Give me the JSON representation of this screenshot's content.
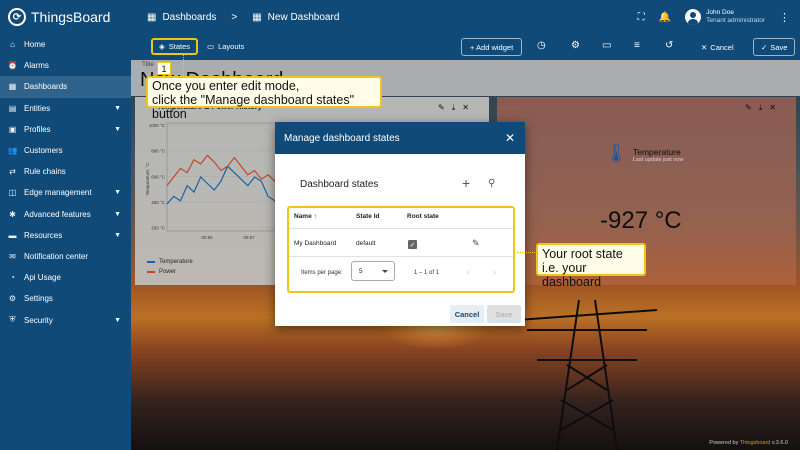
{
  "app": {
    "logo_text": "ThingsBoard"
  },
  "sidebar": {
    "items": [
      {
        "label": "Home",
        "icon": "home-icon",
        "glyph": "⌂",
        "expandable": false,
        "active": false
      },
      {
        "label": "Alarms",
        "icon": "alarm-icon",
        "glyph": "⏰",
        "expandable": false,
        "active": false
      },
      {
        "label": "Dashboards",
        "icon": "dashboards-icon",
        "glyph": "▦",
        "expandable": false,
        "active": true
      },
      {
        "label": "Entities",
        "icon": "entities-icon",
        "glyph": "▤",
        "expandable": true,
        "active": false
      },
      {
        "label": "Profiles",
        "icon": "profiles-icon",
        "glyph": "▣",
        "expandable": true,
        "active": false
      },
      {
        "label": "Customers",
        "icon": "customers-icon",
        "glyph": "👥",
        "expandable": false,
        "active": false
      },
      {
        "label": "Rule chains",
        "icon": "rule-chains-icon",
        "glyph": "⇄",
        "expandable": false,
        "active": false
      },
      {
        "label": "Edge management",
        "icon": "edge-icon",
        "glyph": "◫",
        "expandable": true,
        "active": false
      },
      {
        "label": "Advanced features",
        "icon": "advanced-icon",
        "glyph": "✱",
        "expandable": true,
        "active": false
      },
      {
        "label": "Resources",
        "icon": "resources-icon",
        "glyph": "▬",
        "expandable": true,
        "active": false
      },
      {
        "label": "Notification center",
        "icon": "notification-icon",
        "glyph": "✉",
        "expandable": false,
        "active": false
      },
      {
        "label": "Api Usage",
        "icon": "api-usage-icon",
        "glyph": "◔",
        "expandable": false,
        "active": false
      },
      {
        "label": "Settings",
        "icon": "settings-icon",
        "glyph": "⚙",
        "expandable": false,
        "active": false
      },
      {
        "label": "Security",
        "icon": "security-icon",
        "glyph": "⛨",
        "expandable": true,
        "active": false
      }
    ]
  },
  "header": {
    "breadcrumb_root": "Dashboards",
    "breadcrumb_separator": ">",
    "breadcrumb_current": "New Dashboard",
    "user_name": "John Doe",
    "user_role": "Tenant administrator"
  },
  "toolbar": {
    "states_label": "States",
    "layouts_label": "Layouts",
    "add_widget_label": "+ Add widget",
    "cancel_label": "Cancel",
    "save_label": "Save"
  },
  "dashboard": {
    "title_label": "Title",
    "title": "New Dashboard"
  },
  "widget_chart": {
    "title": "Temperature & Power History",
    "legend": [
      {
        "name": "Temperature",
        "color": "#1f77d0"
      },
      {
        "name": "Power",
        "color": "#e85a3a"
      }
    ]
  },
  "chart_data": {
    "type": "line",
    "title": "",
    "ylabel": "Temperature, °C",
    "yticks": [
      "1000 °C",
      "800 °C",
      "600 °C",
      "400 °C",
      "200 °C"
    ],
    "xticks": [
      "00:55",
      "00:57",
      "00:59"
    ],
    "series": [
      {
        "name": "Temperature",
        "color": "#1f77d0",
        "values": [
          350,
          420,
          380,
          520,
          460,
          600,
          540,
          480,
          560,
          700,
          640,
          580,
          520,
          600,
          560,
          420,
          380,
          300,
          340,
          260
        ]
      },
      {
        "name": "Power",
        "color": "#e85a3a",
        "values": [
          520,
          600,
          680,
          640,
          760,
          720,
          800,
          740,
          660,
          700,
          780,
          700,
          620,
          660,
          580,
          620,
          560,
          480,
          440,
          400
        ]
      }
    ]
  },
  "widget_temp": {
    "label": "Temperature",
    "sub": "Last update just now",
    "value": "-927 °C"
  },
  "dialog": {
    "title": "Manage dashboard states",
    "subtitle": "Dashboard states",
    "columns": [
      "Name ↑",
      "State Id",
      "Root state"
    ],
    "row": {
      "name": "My Dashboard",
      "state_id": "default",
      "root": true
    },
    "items_per_page_label": "Items per page:",
    "items_per_page_value": "5",
    "range_label": "1 – 1 of 1",
    "cancel_label": "Cancel",
    "save_label": "Save"
  },
  "callouts": {
    "step_number": "1",
    "step_text_1": "Once you enter edit mode,",
    "step_text_2": "click the \"Manage dashboard states\" button",
    "root_text_1": "Your root state",
    "root_text_2": "i.e. your dashboard"
  },
  "footer": {
    "prefix": "Powered by",
    "brand": "Thingsboard",
    "version": "v.3.6.0"
  },
  "colors": {
    "primary": "#0f4a78",
    "accent": "#f0c419"
  }
}
